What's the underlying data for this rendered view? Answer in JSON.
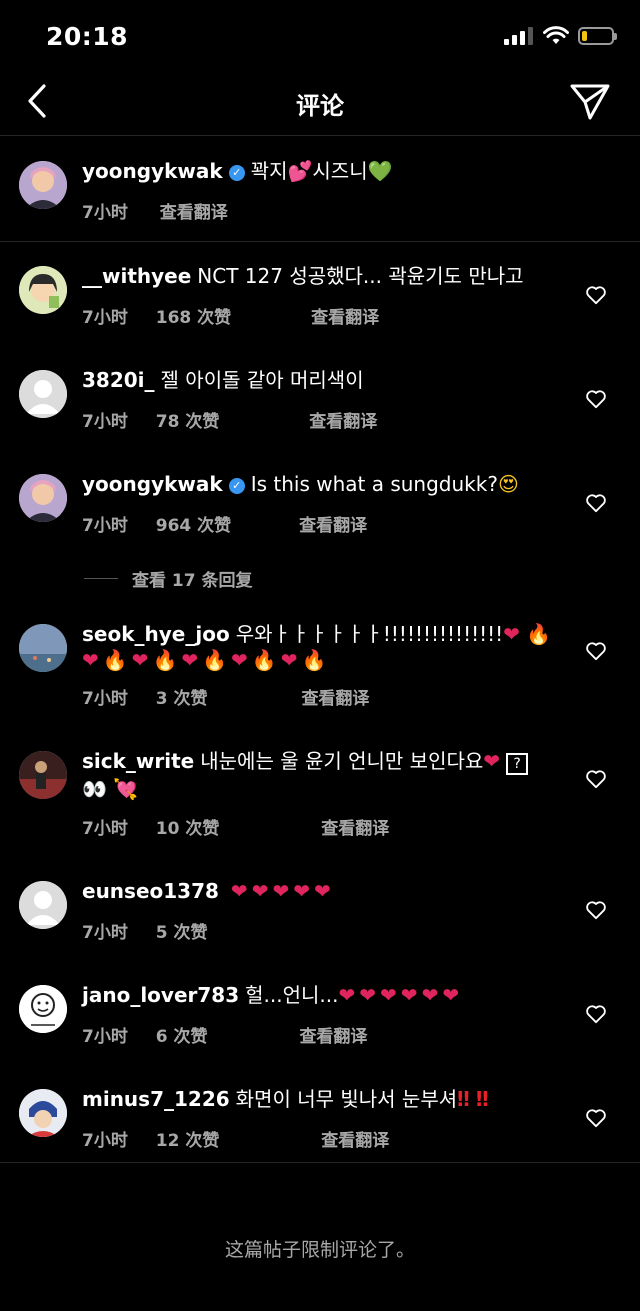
{
  "status_bar": {
    "time": "20:18",
    "accent_battery": "#f1c40f"
  },
  "header": {
    "title": "评论",
    "back_icon": "chevron-left-icon",
    "send_icon": "paper-plane-icon"
  },
  "caption": {
    "username": "yoongykwak",
    "verified": true,
    "text_a": "꽉지",
    "text_b": "시즈니",
    "time": "7小时",
    "translate": "查看翻译"
  },
  "comments": [
    {
      "username": "__withyee",
      "text": "NCT 127 성공했다... 곽윤기도 만나고",
      "time": "7小时",
      "likes": "168 次赞",
      "translate": "查看翻译"
    },
    {
      "username": "3820i_",
      "text": "젤 아이돌 같아 머리색이",
      "time": "7小时",
      "likes": "78 次赞",
      "translate": "查看翻译"
    },
    {
      "username": "yoongykwak",
      "verified": true,
      "text": "Is this what a sungdukk?",
      "time": "7小时",
      "likes": "964 次赞",
      "translate": "查看翻译"
    },
    {
      "username": "seok_hye_joo",
      "text": "우와ㅏㅏㅏㅏㅏㅏ!!!!!!!!!!!!!!!",
      "time": "7小时",
      "likes": "3 次赞",
      "translate": "查看翻译"
    },
    {
      "username": "sick_write",
      "text": "내눈에는 울 윤기 언니만 보인다요",
      "time": "7小时",
      "likes": "10 次赞",
      "translate": "查看翻译"
    },
    {
      "username": "eunseo1378",
      "text": "",
      "time": "7小时",
      "likes": "5 次赞",
      "translate": ""
    },
    {
      "username": "jano_lover783",
      "text": "헐...언니...",
      "time": "7小时",
      "likes": "6 次赞",
      "translate": "查看翻译"
    },
    {
      "username": "minus7_1226",
      "text": "화면이 너무 빛나서 눈부셔",
      "time": "7小时",
      "likes": "12 次赞",
      "translate": "查看翻译"
    }
  ],
  "view_replies": "查看 17 条回复",
  "footer_note": "这篇帖子限制评论了。",
  "colors": {
    "background": "#000000",
    "secondary_text": "#a8a8a8",
    "verified_blue": "#3897f0",
    "divider": "#262626"
  }
}
